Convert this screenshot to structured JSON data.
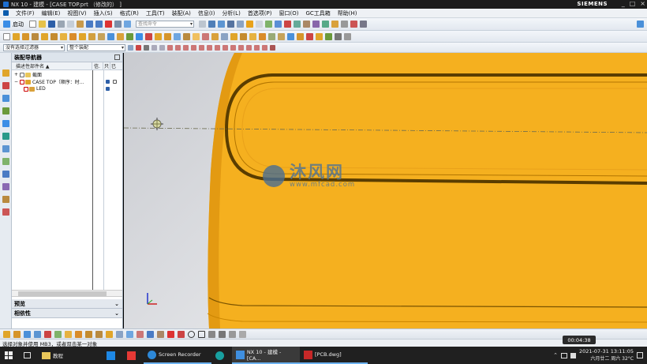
{
  "title_bar": {
    "title": "NX 10 - 建模 - [CASE TOP.prt （修改的） ]",
    "brand": "SIEMENS",
    "controls": [
      "_",
      "□",
      "×"
    ]
  },
  "menu": {
    "items": [
      "文件(F)",
      "编辑(E)",
      "视图(V)",
      "插入(S)",
      "格式(R)",
      "工具(T)",
      "装配(A)",
      "信息(I)",
      "分析(L)",
      "首选项(P)",
      "窗口(O)",
      "GC工具箱",
      "帮助(H)"
    ]
  },
  "toolbar1": {
    "start_label": "启动",
    "search_placeholder": "查找命令"
  },
  "toolbar3": {
    "filter_value": "没有选择过滤器",
    "assembly_value": "整个装配"
  },
  "navigator": {
    "title": "装配导航器",
    "columns": {
      "name": "描述性部件名 ▲",
      "info": "信.",
      "ro": "只",
      "modified": "已"
    },
    "rows": [
      {
        "expander": "+",
        "label": "截面"
      },
      {
        "expander": "−",
        "label": "CASE TOP（顺序：时…"
      },
      {
        "expander": "",
        "label": "LED"
      }
    ],
    "preview_label": "预览",
    "dependency_label": "相依性"
  },
  "watermark": {
    "title": "沐风网",
    "url": "www.mfcad.com"
  },
  "status": {
    "message": "选择对象并使用 MB3，或者双击某一对象",
    "timer": "00:04:38"
  },
  "taskbar": {
    "items": [
      {
        "label": "",
        "icon": "windows-start-icon"
      },
      {
        "label": "",
        "icon": "task-view-icon"
      },
      {
        "label": "教程",
        "icon": "folder-icon"
      },
      {
        "label": "",
        "icon": "app-blue-icon"
      },
      {
        "label": "",
        "icon": "app-red-icon"
      },
      {
        "label": "Screen Recorder",
        "icon": "screen-recorder-icon"
      },
      {
        "label": "",
        "icon": "edge-browser-icon"
      },
      {
        "label": "NX 10 - 建模 - [CA...",
        "icon": "nx-icon"
      },
      {
        "label": "[PCB.dwg]",
        "icon": "autocad-icon"
      }
    ],
    "clock_date": "2021-07-31 13:11:05",
    "clock_sub": "六月廿二 周六 32°C"
  },
  "colors": {
    "part_yellow": "#f6b21c",
    "part_dark": "#5a3d00",
    "accent_blue": "#0b5cad"
  }
}
